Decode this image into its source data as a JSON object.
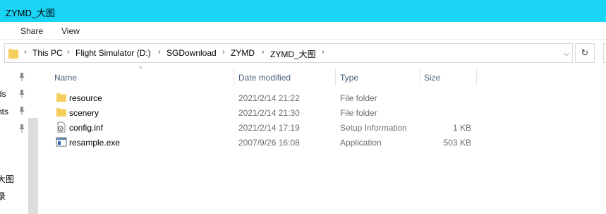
{
  "window": {
    "title": "ZYMD_大图"
  },
  "ribbon": {
    "tabs": [
      "Share",
      "View"
    ]
  },
  "address": {
    "crumbs": [
      "This PC",
      "Flight Simulator (D:)",
      "SGDownload",
      "ZYMD",
      "ZYMD_大图"
    ],
    "dropdown_icon": "chevron-down-icon",
    "refresh_icon": "refresh-icon"
  },
  "nav": {
    "items": [
      "ds",
      "nts",
      "大图",
      "录"
    ]
  },
  "columns": {
    "name": "Name",
    "date": "Date modified",
    "type": "Type",
    "size": "Size"
  },
  "files": [
    {
      "name": "resource",
      "date": "2021/2/14 21:22",
      "type": "File folder",
      "size": "",
      "icon": "folder-icon"
    },
    {
      "name": "scenery",
      "date": "2021/2/14 21:30",
      "type": "File folder",
      "size": "",
      "icon": "folder-icon"
    },
    {
      "name": "config.inf",
      "date": "2021/2/14 17:19",
      "type": "Setup Information",
      "size": "1 KB",
      "icon": "settings-file-icon"
    },
    {
      "name": "resample.exe",
      "date": "2007/9/26 16:08",
      "type": "Application",
      "size": "503 KB",
      "icon": "application-icon"
    }
  ],
  "colors": {
    "titlebar": "#1ad4f6",
    "folder": "#f8d775",
    "header_text": "#4c607a",
    "secondary_text": "#6d6d6d"
  }
}
